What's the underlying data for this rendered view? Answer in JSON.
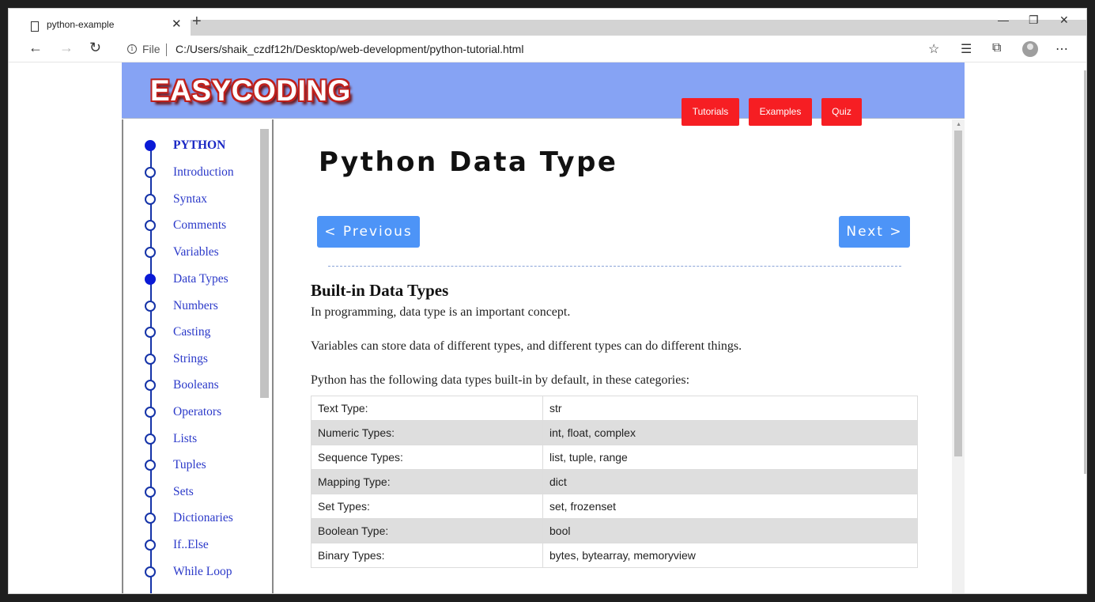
{
  "browser": {
    "tab_title": "python-example",
    "new_tab": "+",
    "file_label": "File",
    "url": "C:/Users/shaik_czdf12h/Desktop/web-development/python-tutorial.html"
  },
  "site": {
    "logo": "EASYCODING",
    "nav": [
      "Tutorials",
      "Examples",
      "Quiz"
    ],
    "accent_color": "#f61e23",
    "header_color": "#86a3f4"
  },
  "sidebar": {
    "items": [
      {
        "label": "PYTHON"
      },
      {
        "label": "Introduction"
      },
      {
        "label": "Syntax"
      },
      {
        "label": "Comments"
      },
      {
        "label": "Variables"
      },
      {
        "label": "Data Types"
      },
      {
        "label": "Numbers"
      },
      {
        "label": "Casting"
      },
      {
        "label": "Strings"
      },
      {
        "label": "Booleans"
      },
      {
        "label": "Operators"
      },
      {
        "label": "Lists"
      },
      {
        "label": "Tuples"
      },
      {
        "label": "Sets"
      },
      {
        "label": "Dictionaries"
      },
      {
        "label": "If..Else"
      },
      {
        "label": "While Loop"
      }
    ]
  },
  "main": {
    "title": "Python Data Type",
    "prev_label": "< Previous",
    "next_label": "Next >",
    "section_heading": "Built-in Data Types",
    "paragraphs": [
      "In programming, data type is an important concept.",
      "Variables can store data of different types, and different types can do different things.",
      "Python has the following data types built-in by default, in these categories:"
    ],
    "table": [
      [
        "Text Type:",
        "str"
      ],
      [
        "Numeric Types:",
        "int, float, complex"
      ],
      [
        "Sequence Types:",
        "list, tuple, range"
      ],
      [
        "Mapping Type:",
        "dict"
      ],
      [
        "Set Types:",
        "set, frozenset"
      ],
      [
        "Boolean Type:",
        "bool"
      ],
      [
        "Binary Types:",
        "bytes, bytearray, memoryview"
      ]
    ]
  }
}
